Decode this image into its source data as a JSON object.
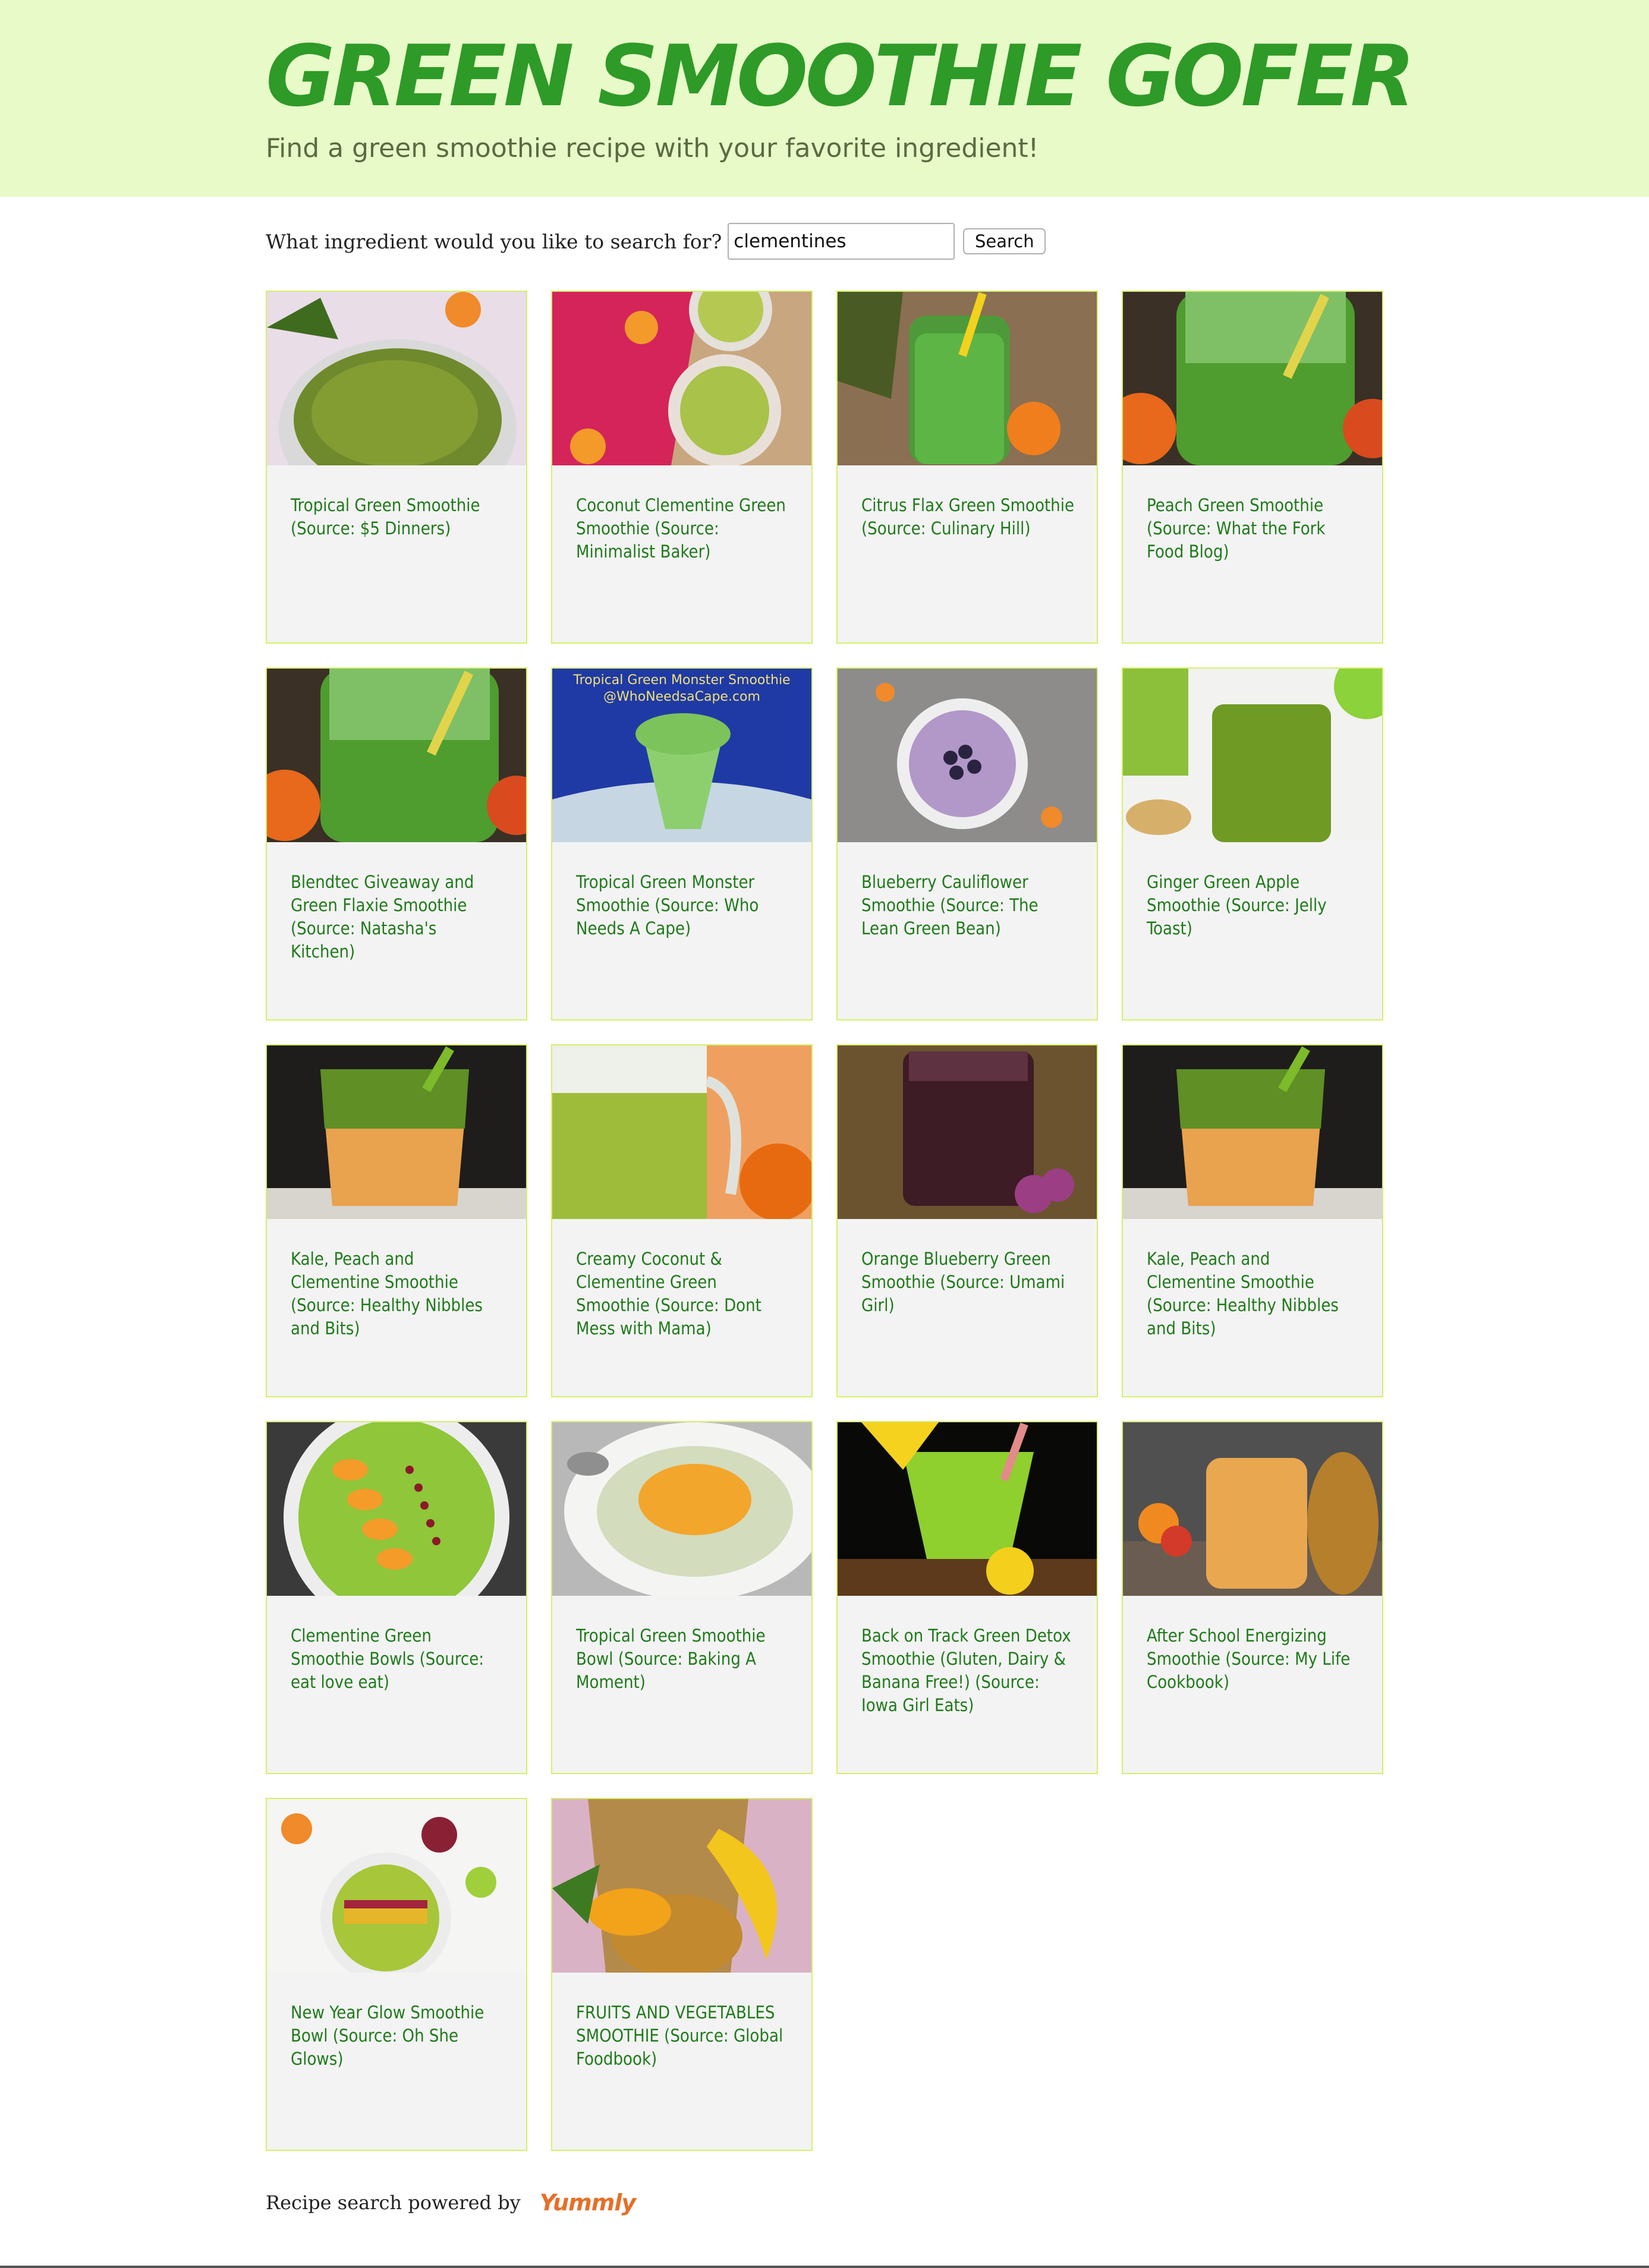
{
  "header": {
    "title": "Green Smoothie Gofer",
    "subtitle": "Find a green smoothie recipe with your favorite ingredient!",
    "background_color": "#e8fac8",
    "title_color": "#2e9a28"
  },
  "search": {
    "label": "What ingredient would you like to search for?",
    "value": "clementines",
    "button_label": "Search"
  },
  "recipes": [
    {
      "title": "Tropical Green Smoothie (Source: $5 Dinners)",
      "image": "green-smoothie-bowl-image"
    },
    {
      "title": "Coconut Clementine Green Smoothie (Source: Minimalist Baker)",
      "image": "green-smoothie-with-clementines-image"
    },
    {
      "title": "Citrus Flax Green Smoothie (Source: Culinary Hill)",
      "image": "green-smoothie-jar-image"
    },
    {
      "title": "Peach Green Smoothie (Source: What the Fork Food Blog)",
      "image": "green-smoothie-glass-image"
    },
    {
      "title": "Blendtec Giveaway and Green Flaxie Smoothie (Source: Natasha's Kitchen)",
      "image": "green-smoothie-glass-image"
    },
    {
      "title": "Tropical Green Monster Smoothie (Source: Who Needs A Cape)",
      "image": "green-monster-smoothie-image"
    },
    {
      "title": "Blueberry Cauliflower Smoothie (Source: The Lean Green Bean)",
      "image": "blueberry-smoothie-image"
    },
    {
      "title": "Ginger Green Apple Smoothie (Source: Jelly Toast)",
      "image": "ginger-apple-smoothie-image"
    },
    {
      "title": "Kale, Peach and Clementine Smoothie (Source: Healthy Nibbles and Bits)",
      "image": "layered-smoothie-image"
    },
    {
      "title": "Creamy Coconut & Clementine Green Smoothie (Source: Dont Mess with Mama)",
      "image": "creamy-smoothie-mug-image"
    },
    {
      "title": "Orange Blueberry Green Smoothie (Source: Umami Girl)",
      "image": "purple-smoothie-image"
    },
    {
      "title": "Kale, Peach and Clementine Smoothie (Source: Healthy Nibbles and Bits)",
      "image": "layered-smoothie-image"
    },
    {
      "title": "Clementine Green Smoothie Bowls (Source: eat love eat)",
      "image": "smoothie-bowl-clementines-image"
    },
    {
      "title": "Tropical Green Smoothie Bowl (Source: Baking A Moment)",
      "image": "smoothie-bowl-plate-image"
    },
    {
      "title": "Back on Track Green Detox Smoothie (Gluten, Dairy & Banana Free!) (Source: Iowa Girl Eats)",
      "image": "green-detox-smoothie-image"
    },
    {
      "title": "After School Energizing Smoothie (Source: My Life Cookbook)",
      "image": "orange-smoothie-jar-image"
    },
    {
      "title": "New Year Glow Smoothie Bowl (Source: Oh She Glows)",
      "image": "glow-smoothie-bowl-image"
    },
    {
      "title": "FRUITS AND VEGETABLES SMOOTHIE (Source: Global Foodbook)",
      "image": "fruit-vegetable-smoothie-image"
    }
  ],
  "overlay_text": {
    "line1": "Tropical Green Monster Smoothie",
    "line2": "@WhoNeedsaCape.com"
  },
  "footer": {
    "text": "Recipe search powered by",
    "logo": "Yummly",
    "logo_color": "#e5702a"
  },
  "colors": {
    "card_border": "#d4f06a",
    "card_background": "#f3f3f3",
    "card_text": "#1f7a1a"
  }
}
